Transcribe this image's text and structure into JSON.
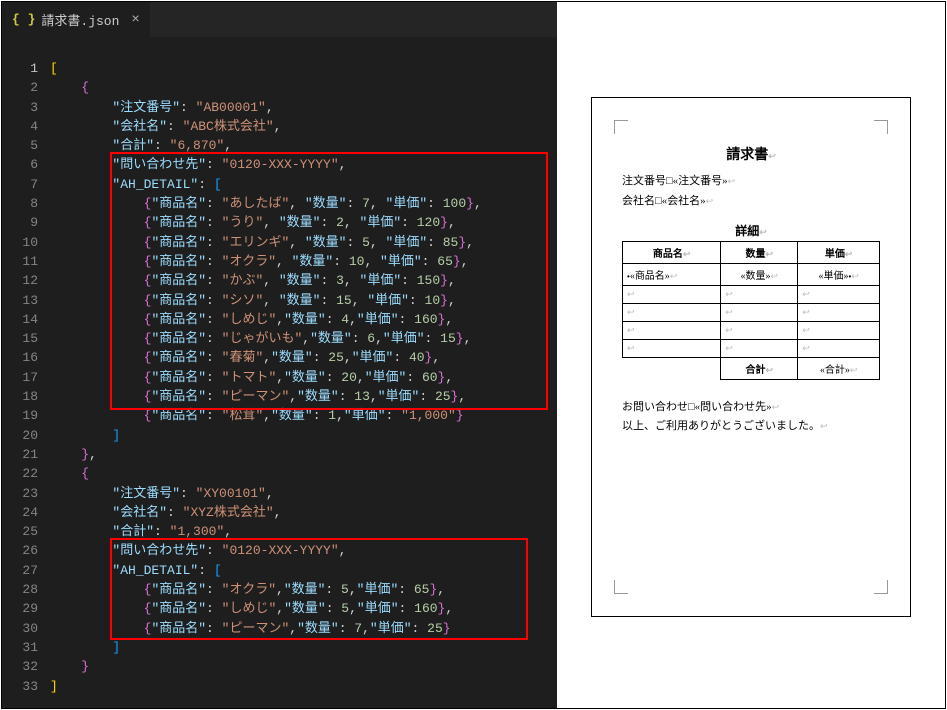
{
  "tab": {
    "icon": "{ }",
    "filename": "請求書.json",
    "close": "×"
  },
  "lines": [
    1,
    2,
    3,
    4,
    5,
    6,
    7,
    8,
    9,
    10,
    11,
    12,
    13,
    14,
    15,
    16,
    17,
    18,
    19,
    20,
    21,
    22,
    23,
    24,
    25,
    26,
    27,
    28,
    29,
    30,
    31,
    32,
    33
  ],
  "code": {
    "l1": "[",
    "l2": "{",
    "k_order": "注文番号",
    "v_order1": "AB00001",
    "k_company": "会社名",
    "v_company1": "ABC株式会社",
    "k_total": "合計",
    "v_total1": "6,870",
    "k_contact": "問い合わせ先",
    "v_contact": "0120-XXX-YYYY",
    "k_detail": "AH_DETAIL",
    "k_name": "商品名",
    "k_qty": "数量",
    "k_price": "単価",
    "d1": {
      "n": "あしたば",
      "q": "7",
      "p": "100"
    },
    "d2": {
      "n": "うり",
      "q": "2",
      "p": "120"
    },
    "d3": {
      "n": "エリンギ",
      "q": "5",
      "p": "85"
    },
    "d4": {
      "n": "オクラ",
      "q": "10",
      "p": "65"
    },
    "d5": {
      "n": "かぶ",
      "q": "3",
      "p": "150"
    },
    "d6": {
      "n": "シソ",
      "q": "15",
      "p": "10"
    },
    "d7": {
      "n": "しめじ",
      "q": "4",
      "p": "160"
    },
    "d8": {
      "n": "じゃがいも",
      "q": "6",
      "p": "15"
    },
    "d9": {
      "n": "春菊",
      "q": "25",
      "p": "40"
    },
    "d10": {
      "n": "トマト",
      "q": "20",
      "p": "60"
    },
    "d11": {
      "n": "ピーマン",
      "q": "13",
      "p": "25"
    },
    "d12": {
      "n": "松茸",
      "q": "1",
      "p": "1,000"
    },
    "v_order2": "XY00101",
    "v_company2": "XYZ株式会社",
    "v_total2": "1,300",
    "e1": {
      "n": "オクラ",
      "q": "5",
      "p": "65"
    },
    "e2": {
      "n": "しめじ",
      "q": "5",
      "p": "160"
    },
    "e3": {
      "n": "ピーマン",
      "q": "7",
      "p": "25"
    }
  },
  "doc": {
    "title": "請求書",
    "order_label": "注文番号",
    "order_ph": "«注文番号»",
    "company_label": "会社名",
    "company_ph": "«会社名»",
    "detail_label": "詳細",
    "th_name": "商品名",
    "th_qty": "数量",
    "th_price": "単価",
    "row_name": "«商品名»",
    "row_qty": "«数量»",
    "row_price": "«単価»",
    "sum_label": "合計",
    "sum_ph": "«合計»",
    "contact_label": "お問い合わせ",
    "contact_ph": "«問い合わせ先»",
    "footer": "以上、ご利用ありがとうございました。"
  }
}
